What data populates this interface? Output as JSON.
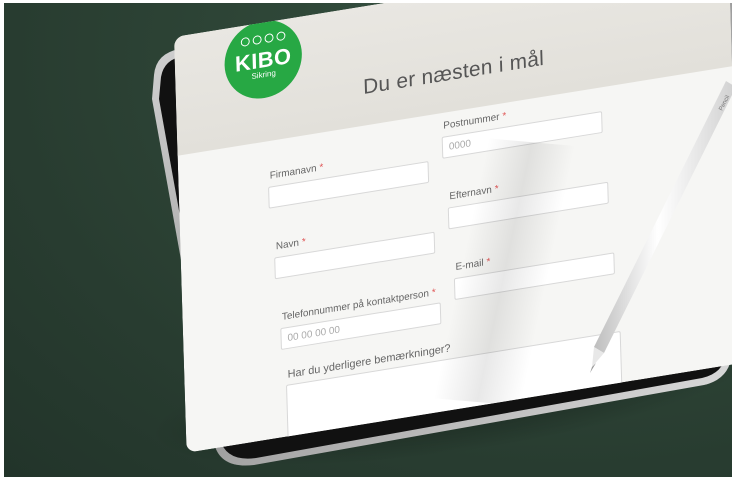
{
  "brand": {
    "name": "KIBO",
    "tagline": "Sikring",
    "color": "#27a844"
  },
  "form": {
    "title": "Du er næsten i mål",
    "required_marker": "*",
    "fields": {
      "firmanavn": {
        "label": "Firmanavn",
        "value": "",
        "placeholder": ""
      },
      "postnummer": {
        "label": "Postnummer",
        "value": "",
        "placeholder": "0000"
      },
      "navn": {
        "label": "Navn",
        "value": "",
        "placeholder": ""
      },
      "efternavn": {
        "label": "Efternavn",
        "value": "",
        "placeholder": ""
      },
      "telefon": {
        "label": "Telefonnummer på kontaktperson",
        "value": "",
        "placeholder": "00 00 00 00"
      },
      "email": {
        "label": "E-mail",
        "value": "",
        "placeholder": ""
      },
      "bemaerkninger": {
        "label": "Har du yderligere bemærkninger?",
        "value": ""
      }
    }
  },
  "stylus": {
    "brand_mark": "Pencil"
  },
  "colors": {
    "background": "#2f4738",
    "required": "#e05a5a",
    "banner": "#e6e4df"
  }
}
